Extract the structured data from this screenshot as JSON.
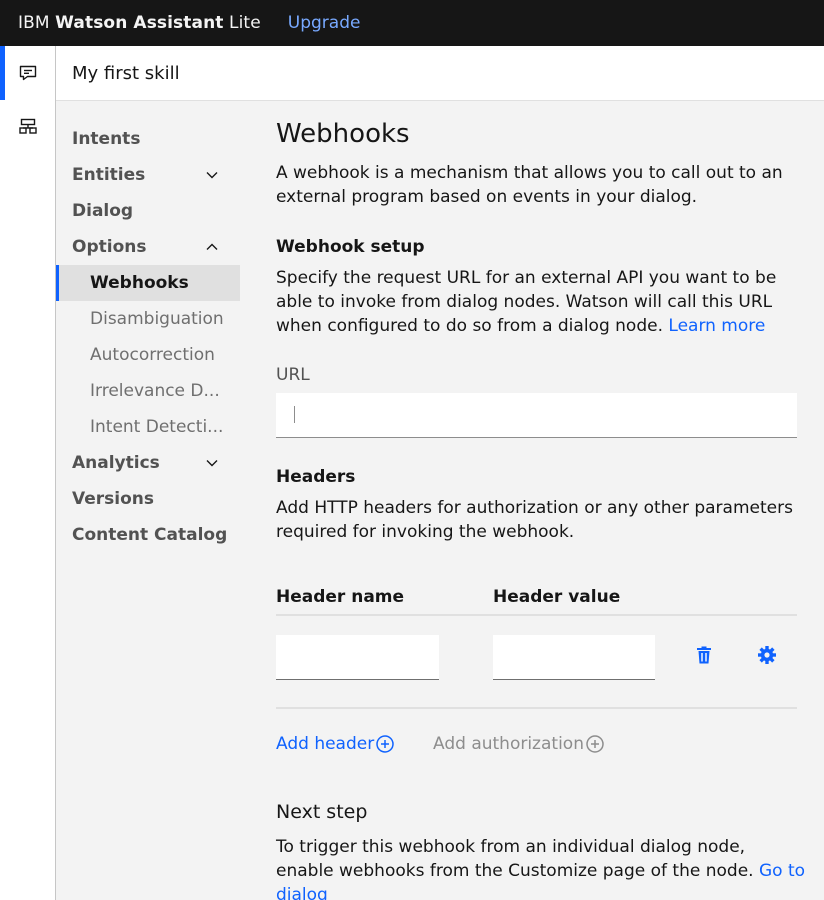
{
  "topbar": {
    "company": "IBM",
    "product": "Watson Assistant",
    "plan": "Lite",
    "upgrade_label": "Upgrade"
  },
  "rail": {
    "items": [
      {
        "icon": "chat-icon",
        "active": true
      },
      {
        "icon": "skills-icon",
        "active": false
      }
    ]
  },
  "skill": {
    "name": "My first skill"
  },
  "nav": {
    "intents": "Intents",
    "entities": "Entities",
    "dialog": "Dialog",
    "options": "Options",
    "options_sub": [
      "Webhooks",
      "Disambiguation",
      "Autocorrection",
      "Irrelevance D...",
      "Intent Detecti..."
    ],
    "analytics": "Analytics",
    "versions": "Versions",
    "content_catalog": "Content Catalog"
  },
  "page": {
    "title": "Webhooks",
    "intro": "A webhook is a mechanism that allows you to call out to an external program based on events in your dialog.",
    "setup_title": "Webhook setup",
    "setup_text": "Specify the request URL for an external API you want to be able to invoke from dialog nodes. Watson will call this URL when configured to do so from a dialog node.",
    "learn_more": "Learn more",
    "url_label": "URL",
    "url_value": "",
    "headers_title": "Headers",
    "headers_text": "Add HTTP headers for authorization or any other parameters required for invoking the webhook.",
    "col_name": "Header name",
    "col_value": "Header value",
    "add_header": "Add header",
    "add_authorization": "Add authorization",
    "next_title": "Next step",
    "next_text": "To trigger this webhook from an individual dialog node, enable webhooks from the Customize page of the node.",
    "go_to_dialog": "Go to dialog"
  },
  "colors": {
    "accent": "#0f62fe",
    "topbar_bg": "#161616",
    "link_on_dark": "#78a9ff"
  }
}
